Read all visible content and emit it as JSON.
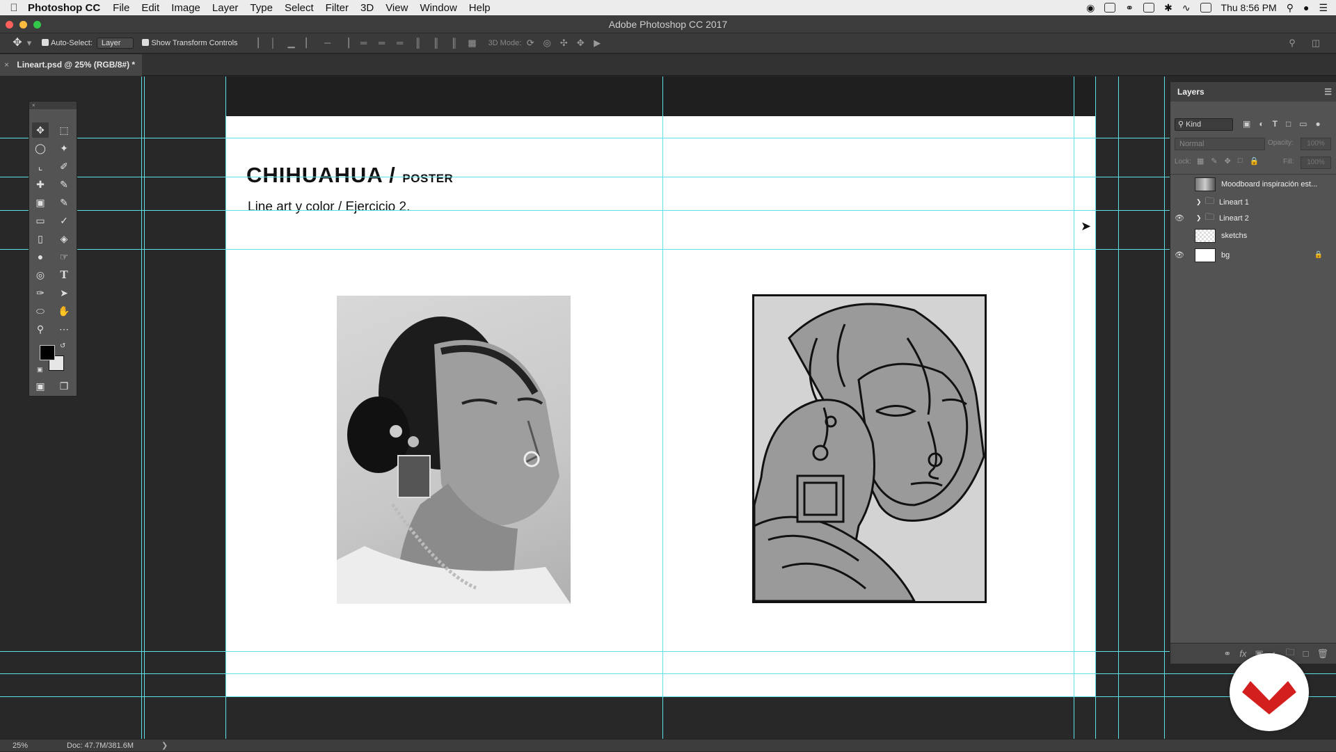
{
  "menubar": {
    "app": "Photoshop CC",
    "items": [
      "File",
      "Edit",
      "Image",
      "Layer",
      "Type",
      "Select",
      "Filter",
      "3D",
      "View",
      "Window",
      "Help"
    ],
    "clock": "Thu 8:56 PM"
  },
  "window": {
    "title": "Adobe Photoshop CC 2017"
  },
  "options": {
    "auto_select_label": "Auto-Select:",
    "auto_select_value": "Layer",
    "transform_label": "Show Transform Controls",
    "mode_label": "3D Mode:"
  },
  "document": {
    "tab": "Lineart.psd @ 25% (RGB/8#) *"
  },
  "canvas": {
    "title": "CHIHUAHUA /",
    "title_small": "POSTER",
    "subtitle": "Line art y color / Ejercicio 2."
  },
  "layers": {
    "panel_title": "Layers",
    "kind": "Kind",
    "blend": "Normal",
    "opacity_label": "Opacity:",
    "opacity_value": "100%",
    "lock_label": "Lock:",
    "fill_label": "Fill:",
    "fill_value": "100%",
    "rows": [
      {
        "name": "Moodboard inspiración est...",
        "visible": false
      },
      {
        "name": "Lineart 1",
        "visible": false
      },
      {
        "name": "Lineart 2",
        "visible": true
      },
      {
        "name": "sketchs",
        "visible": false
      },
      {
        "name": "bg",
        "visible": true
      }
    ]
  },
  "status": {
    "zoom": "25%",
    "doc": "Doc: 47.7M/381.6M"
  },
  "colors": {
    "guide": "#5ee0e6",
    "badge_red": "#d3201e",
    "foreground": "#000000",
    "background": "#e6e6e6"
  }
}
